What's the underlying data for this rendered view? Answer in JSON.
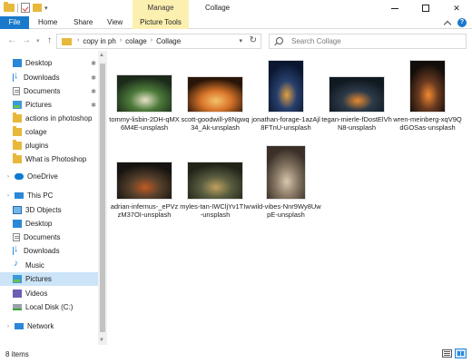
{
  "window": {
    "title": "Collage",
    "context_tab_group": "Manage"
  },
  "quick_access_toolbar": {
    "icons": [
      "folder-icon",
      "properties-check-icon",
      "new-folder-icon",
      "customize-dropdown-icon"
    ],
    "dropdown_glyph": "▾"
  },
  "window_controls": {
    "close_glyph": "✕"
  },
  "ribbon": {
    "tabs": [
      {
        "label": "File"
      },
      {
        "label": "Home"
      },
      {
        "label": "Share"
      },
      {
        "label": "View"
      },
      {
        "label": "Picture Tools"
      }
    ],
    "help_glyph": "?"
  },
  "address": {
    "back_glyph": "←",
    "forward_glyph": "→",
    "recent_glyph": "▾",
    "up_glyph": "↑",
    "crumb_separator": "›",
    "breadcrumbs": [
      "copy in ph",
      "colage",
      "Collage"
    ],
    "dropdown_glyph": "▾",
    "refresh_glyph": "↻"
  },
  "search": {
    "placeholder": "Search Collage"
  },
  "sidebar": {
    "items": [
      {
        "label": "Desktop",
        "icon": "desktop-icon",
        "pinned": true
      },
      {
        "label": "Downloads",
        "icon": "download-icon",
        "pinned": true
      },
      {
        "label": "Documents",
        "icon": "documents-icon",
        "pinned": true
      },
      {
        "label": "Pictures",
        "icon": "pictures-icon",
        "pinned": true
      },
      {
        "label": "actions in photoshop",
        "icon": "folder-icon",
        "pinned": false
      },
      {
        "label": "colage",
        "icon": "folder-icon",
        "pinned": false
      },
      {
        "label": "plugins",
        "icon": "folder-icon",
        "pinned": false
      },
      {
        "label": "What is Photoshop",
        "icon": "folder-icon",
        "pinned": false
      },
      {
        "label": "OneDrive",
        "icon": "onedrive-icon",
        "pinned": false
      },
      {
        "label": "This PC",
        "icon": "pc-icon",
        "pinned": false
      },
      {
        "label": "3D Objects",
        "icon": "3d-objects-icon",
        "pinned": false
      },
      {
        "label": "Desktop",
        "icon": "desktop-icon",
        "pinned": false
      },
      {
        "label": "Documents",
        "icon": "documents-icon",
        "pinned": false
      },
      {
        "label": "Downloads",
        "icon": "download-icon",
        "pinned": false
      },
      {
        "label": "Music",
        "icon": "music-icon",
        "pinned": false
      },
      {
        "label": "Pictures",
        "icon": "pictures-icon",
        "pinned": false,
        "selected": true
      },
      {
        "label": "Videos",
        "icon": "videos-icon",
        "pinned": false
      },
      {
        "label": "Local Disk (C:)",
        "icon": "disk-icon",
        "pinned": false
      },
      {
        "label": "Network",
        "icon": "network-icon",
        "pinned": false
      }
    ],
    "pin_glyph": "📌",
    "expander_glyph": "›"
  },
  "files": [
    {
      "name": "tommy-lisbin-2DH-qMX6M4E-unsplash",
      "colors": [
        "#1c2a1a",
        "#4d7b3a",
        "#e8e2c8"
      ]
    },
    {
      "name": "scott-goodwill-y8Ngwq34_Ak-unsplash",
      "colors": [
        "#2a1608",
        "#d8742a",
        "#f4c36a"
      ]
    },
    {
      "name": "jonathan-forage-1azAjl8FTnU-unsplash",
      "colors": [
        "#0b1730",
        "#28406e",
        "#e0a040"
      ]
    },
    {
      "name": "tegan-mierle-fDostElVhN8-unsplash",
      "colors": [
        "#101820",
        "#2c3a48",
        "#e88a30"
      ]
    },
    {
      "name": "wren-meinberg-xqV9QdGOSas-unsplash",
      "colors": [
        "#120d0a",
        "#6a3a20",
        "#f08a30"
      ]
    },
    {
      "name": "adrian-infernus-_ePVzzM37OI-unsplash",
      "colors": [
        "#161310",
        "#56402c",
        "#c05a24"
      ]
    },
    {
      "name": "myles-tan-IWCljYv1TIw-unsplash",
      "colors": [
        "#222418",
        "#5a5e40",
        "#c0a060"
      ]
    },
    {
      "name": "wild-vibes-Nnr9Wy8UwpE-unsplash",
      "colors": [
        "#3a3028",
        "#8a7a66",
        "#d8c8b0"
      ]
    }
  ],
  "status": {
    "item_count": "8 items"
  }
}
